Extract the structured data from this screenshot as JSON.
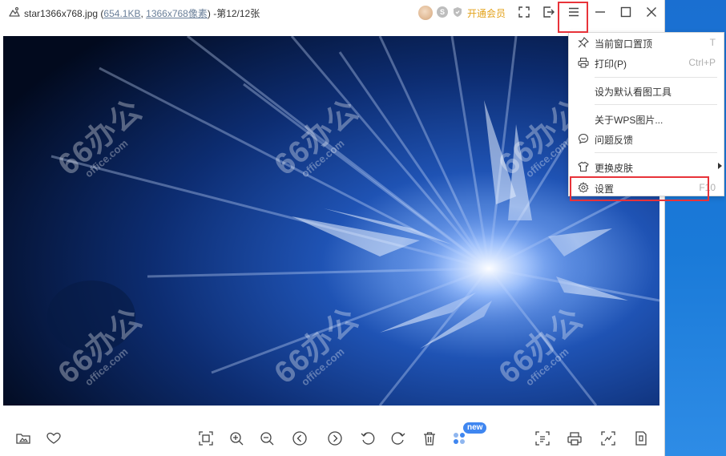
{
  "window": {
    "filename": "star1366x768.jpg",
    "title_open": " (",
    "file_size": "654.1KB",
    "comma": ", ",
    "resolution": "1366x768像素",
    "title_close": ")",
    "position": " -第12/12张"
  },
  "vip": {
    "badge_letter": "S",
    "label": "开通会员"
  },
  "watermark": {
    "big": "66办公",
    "small": "office.com"
  },
  "menu": {
    "items": [
      {
        "label": "当前窗口置顶",
        "shortcut": "T"
      },
      {
        "label": "打印(P)",
        "shortcut": "Ctrl+P"
      },
      {
        "label": "设为默认看图工具",
        "shortcut": ""
      },
      {
        "label": "关于WPS图片...",
        "shortcut": ""
      },
      {
        "label": "问题反馈",
        "shortcut": ""
      },
      {
        "label": "更换皮肤",
        "shortcut": ""
      },
      {
        "label": "设置",
        "shortcut": "F10"
      }
    ]
  },
  "toolbar": {
    "new_badge": "new"
  },
  "colors": {
    "highlight": "#e8333a",
    "vip": "#e3a21a",
    "badge": "#3f86f0"
  }
}
